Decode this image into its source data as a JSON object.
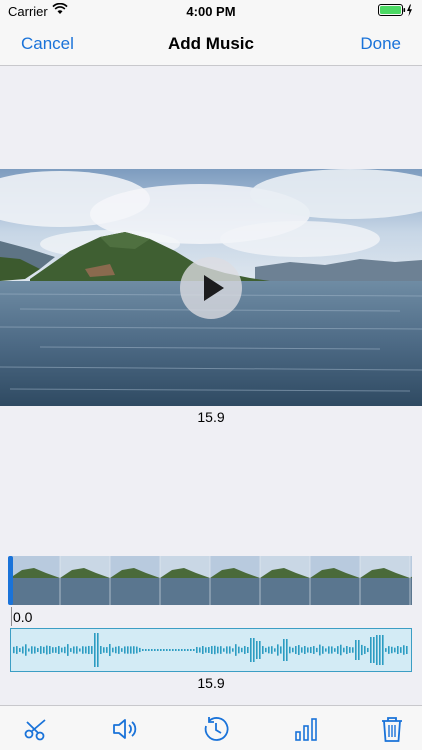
{
  "status_bar": {
    "carrier": "Carrier",
    "time": "4:00 PM",
    "icons": [
      "wifi-icon",
      "battery-icon",
      "charging-bolt-icon"
    ]
  },
  "nav": {
    "cancel_label": "Cancel",
    "title": "Add Music",
    "done_label": "Done"
  },
  "video": {
    "timestamp": "15.9",
    "play_icon": "play-icon"
  },
  "timeline": {
    "start_time": "0.0",
    "audio_duration": "15.9"
  },
  "toolbar": {
    "icons": [
      "scissors-icon",
      "speaker-icon",
      "clock-speed-icon",
      "bar-chart-icon",
      "trash-icon"
    ]
  },
  "colors": {
    "accent": "#1a73d9",
    "waveform": "#2c9cc2",
    "waveform_bg": "#d3ebf5",
    "background": "#efeff4"
  }
}
